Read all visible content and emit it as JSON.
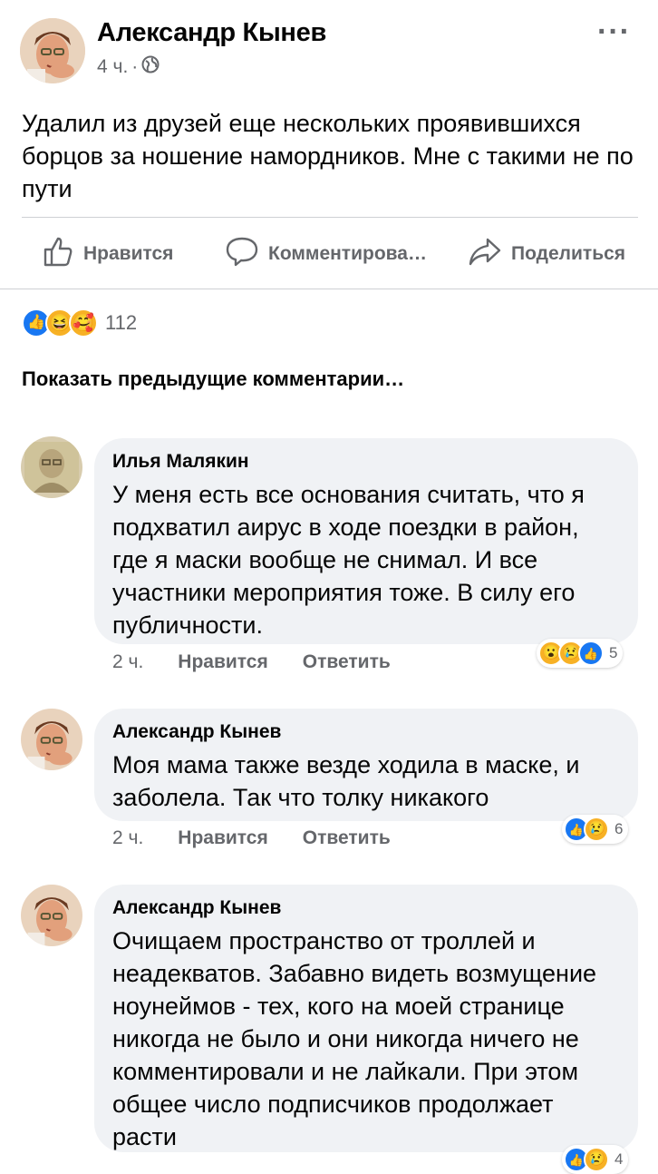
{
  "post": {
    "author": "Александр Кынев",
    "time": "4 ч.",
    "separator": "·",
    "more": "···",
    "text": "Удалил из друзей еще нескольких проявившихся борцов за ношение намордников. Мне с такими не по пути"
  },
  "actions": {
    "like": "Нравится",
    "comment": "Комментирова…",
    "share": "Поделиться"
  },
  "reactions": {
    "count": "112",
    "icons": [
      "like",
      "haha",
      "care"
    ]
  },
  "show_previous": "Показать предыдущие комментарии…",
  "comments": [
    {
      "author": "Илья Малякин",
      "text": "У меня есть все основания считать, что я подхватил аирус в ходе поездки в район, где я маски вообще не снимал. И все участники мероприятия тоже. В силу его публичности.",
      "time": "2 ч.",
      "like": "Нравится",
      "reply": "Ответить",
      "reactions_count": "5",
      "reaction_icons": [
        "wow",
        "sad",
        "like"
      ]
    },
    {
      "author": "Александр Кынев",
      "text": "Моя мама также везде ходила в маске, и заболела. Так что толку никакого",
      "time": "2 ч.",
      "like": "Нравится",
      "reply": "Ответить",
      "reactions_count": "6",
      "reaction_icons": [
        "like",
        "sad"
      ]
    },
    {
      "author": "Александр Кынев",
      "text": "Очищаем пространство от троллей и неадекватов. Забавно видеть возмущение ноунеймов - тех, кого на моей странице никогда не было и они никогда ничего не комментировали и не лайкали. При этом общее число подписчиков продолжает расти",
      "reactions_count": "4",
      "reaction_icons": [
        "like",
        "sad"
      ]
    }
  ],
  "colors": {
    "text": "#050505",
    "secondary": "#65676b",
    "bubble": "#f0f2f5",
    "like_blue": "#1877f2",
    "emoji_yellow": "#f7b125"
  }
}
